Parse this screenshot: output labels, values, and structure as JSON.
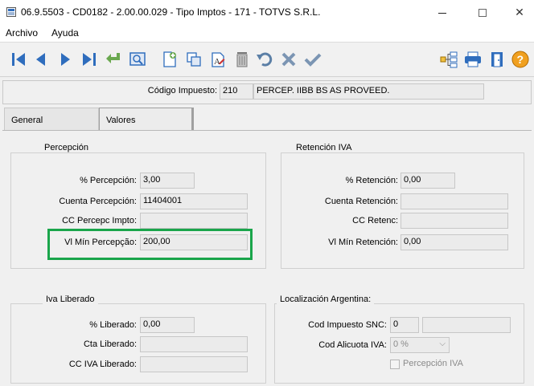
{
  "window": {
    "title": "06.9.5503 - CD0182 - 2.00.00.029 - Tipo Imptos - 171 - TOTVS S.R.L.",
    "close_glyph": "✕"
  },
  "menu": {
    "archivo": "Archivo",
    "ayuda": "Ayuda"
  },
  "header": {
    "codigo_label": "Código Impuesto:",
    "codigo_value": "210",
    "descripcion_value": "PERCEP. IIBB BS AS PROVEED."
  },
  "tabs": {
    "general": "General",
    "valores": "Valores"
  },
  "percepcion": {
    "title": "Percepción",
    "pct_label": "% Percepción:",
    "pct_value": "3,00",
    "cuenta_label": "Cuenta Percepción:",
    "cuenta_value": "11404001",
    "cc_label": "CC Percepc Impto:",
    "cc_value": "",
    "vlmin_label": "Vl Mín Percepção:",
    "vlmin_value": "200,00"
  },
  "retencion": {
    "title": "Retención IVA",
    "pct_label": "% Retención:",
    "pct_value": "0,00",
    "cuenta_label": "Cuenta Retención:",
    "cuenta_value": "",
    "cc_label": "CC Retenc:",
    "cc_value": "",
    "vlmin_label": "Vl Mín Retención:",
    "vlmin_value": "0,00"
  },
  "iva_liberado": {
    "title": "Iva Liberado",
    "pct_label": "% Liberado:",
    "pct_value": "0,00",
    "cta_label": "Cta Liberado:",
    "cta_value": "",
    "cc_label": "CC IVA Liberado:",
    "cc_value": ""
  },
  "localizacion": {
    "title": "Localización Argentina:",
    "snc_label": "Cod Impuesto SNC:",
    "snc_value": "0",
    "snc_desc": "",
    "alicuota_label": "Cod Alicuota IVA:",
    "alicuota_value": "0 %",
    "percepcion_iva_label": "Percepción IVA"
  },
  "colors": {
    "toolbar_blue": "#2f6dbd",
    "highlight_green": "#1aa54b",
    "help_orange": "#f0a020"
  },
  "toolbar_icons": [
    "first-icon",
    "prev-icon",
    "next-icon",
    "last-icon",
    "go-to-icon",
    "search-icon",
    "new-icon",
    "copy-icon",
    "edit-icon",
    "delete-icon",
    "undo-icon",
    "cancel-icon",
    "confirm-icon",
    "tree-icon",
    "print-icon",
    "exit-icon",
    "help-icon"
  ]
}
